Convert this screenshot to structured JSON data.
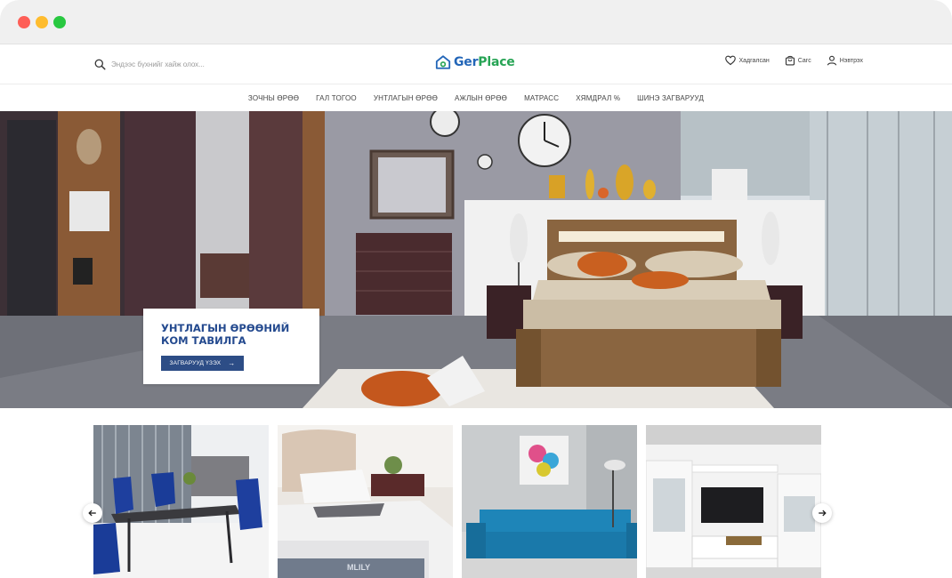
{
  "header": {
    "search_placeholder": "Эндээс бүхнийг хайж олох...",
    "logo_part1": "Ger",
    "logo_part2": "Place",
    "wishlist_label": "Хадгалсан",
    "cart_label": "Сагс",
    "login_label": "Нэвтрэх"
  },
  "nav": {
    "items": [
      "ЗОЧНЫ ӨРӨӨ",
      "ГАЛ ТОГОО",
      "УНТЛАГЫН ӨРӨӨ",
      "АЖЛЫН ӨРӨӨ",
      "МАТРАСС",
      "ХЯМДРАЛ %",
      "ШИНЭ ЗАГВАРУУД"
    ]
  },
  "hero": {
    "promo_title": "УНТЛАГЫН ӨРӨӨНИЙ КОМ ТАВИЛГА",
    "promo_button": "ЗАГВАРУУД ҮЗЭХ",
    "mattress_brand": "MLILY"
  },
  "colors": {
    "brand_blue": "#2366b8",
    "brand_green": "#27a455",
    "promo_blue": "#2d4d86"
  },
  "icons": {
    "search": "search-icon",
    "wishlist": "heart-icon",
    "cart": "bag-icon",
    "login": "user-icon",
    "prev": "arrow-left-icon",
    "next": "arrow-right-icon"
  }
}
